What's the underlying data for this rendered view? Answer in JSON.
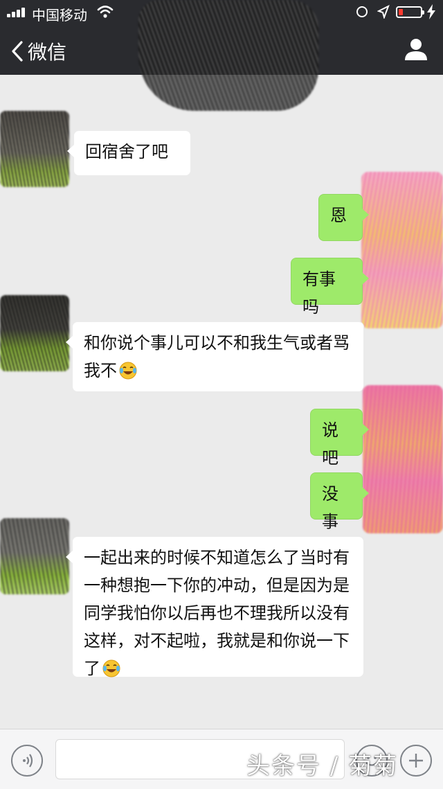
{
  "status_bar": {
    "carrier": "中国移动",
    "icons": [
      "signal-icon",
      "wifi-icon",
      "orientation-lock-icon",
      "location-icon",
      "battery-icon",
      "charging-icon"
    ],
    "battery_color": "#ff3b30"
  },
  "nav_bar": {
    "back_label": "微信",
    "icons": [
      "back-chevron-icon",
      "profile-icon"
    ],
    "background": "#2a2b2f"
  },
  "messages": [
    {
      "side": "left",
      "text": "回宿舍了吧"
    },
    {
      "side": "right",
      "text": "恩"
    },
    {
      "side": "right",
      "text": "有事吗"
    },
    {
      "side": "left",
      "text": "和你说个事儿可以不和我生气或者骂我不",
      "emoji": "tears-of-joy-emoji"
    },
    {
      "side": "right",
      "text": "说吧"
    },
    {
      "side": "right",
      "text": "没事"
    },
    {
      "side": "left",
      "text": "一起出来的时候不知道怎么了当时有一种想抱一下你的冲动，但是因为是同学我怕你以后再也不理我所以没有这样，对不起啦，我就是和你说一下了",
      "emoji": "tears-of-joy-emoji"
    }
  ],
  "colors": {
    "sent_bubble": "#9eea6a",
    "received_bubble": "#ffffff",
    "chat_background": "#ebebeb"
  },
  "input_bar": {
    "text_value": "",
    "icons": [
      "voice-icon",
      "emoji-icon",
      "plus-icon"
    ]
  },
  "watermark": "头条号 / 菊菊"
}
